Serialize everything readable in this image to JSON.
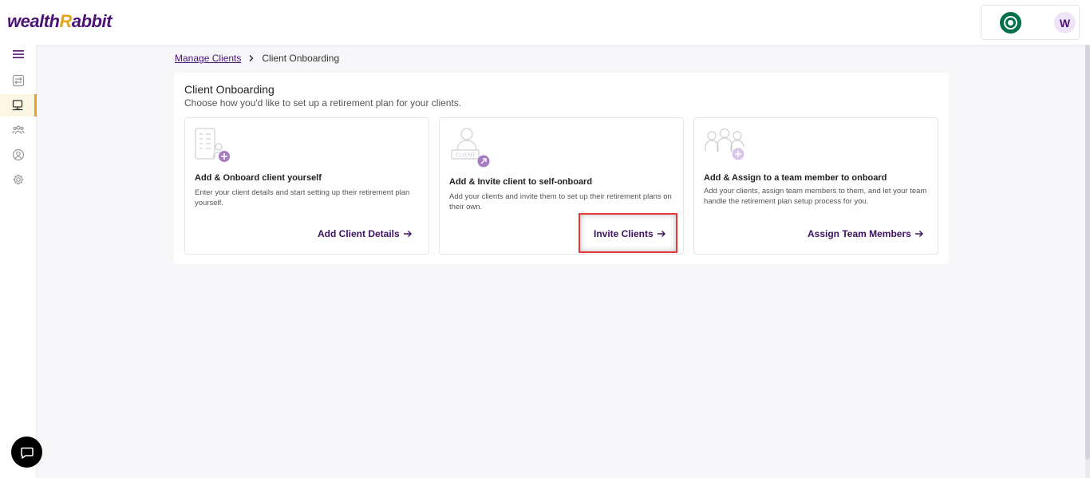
{
  "header": {
    "logo_left": "wealth",
    "logo_accent": "R",
    "logo_right": "abbit",
    "brand_logo_icon": "starbucks-logo",
    "avatar_initial": "W",
    "accent_color": "#e3a51b",
    "brand_color": "#4a1374"
  },
  "sidebar": {
    "items": [
      {
        "icon": "menu-icon"
      },
      {
        "icon": "transfer-icon"
      },
      {
        "icon": "monitor-icon",
        "active": true
      },
      {
        "icon": "team-icon"
      },
      {
        "icon": "user-circle-icon"
      },
      {
        "icon": "gear-icon"
      }
    ]
  },
  "breadcrumb": {
    "parent": "Manage Clients",
    "current": "Client Onboarding"
  },
  "panel": {
    "title": "Client Onboarding",
    "subtitle": "Choose how you'd like to set up a retirement plan for your clients."
  },
  "cards": [
    {
      "title": "Add & Onboard client yourself",
      "description": "Enter your client details and start setting up their retirement plan yourself.",
      "action": "Add Client Details",
      "icon": "document-add-icon"
    },
    {
      "title": "Add & Invite client to self-onboard",
      "description": "Add your clients and invite them to set up their retirement plans on their own.",
      "action": "Invite Clients",
      "icon": "client-invite-icon"
    },
    {
      "title": "Add & Assign to a team member to onboard",
      "description": "Add your clients, assign team members to them, and let your team handle the retirement plan setup process for you.",
      "action": "Assign Team Members",
      "icon": "team-add-icon"
    }
  ],
  "chat": {
    "icon": "chat-icon"
  }
}
